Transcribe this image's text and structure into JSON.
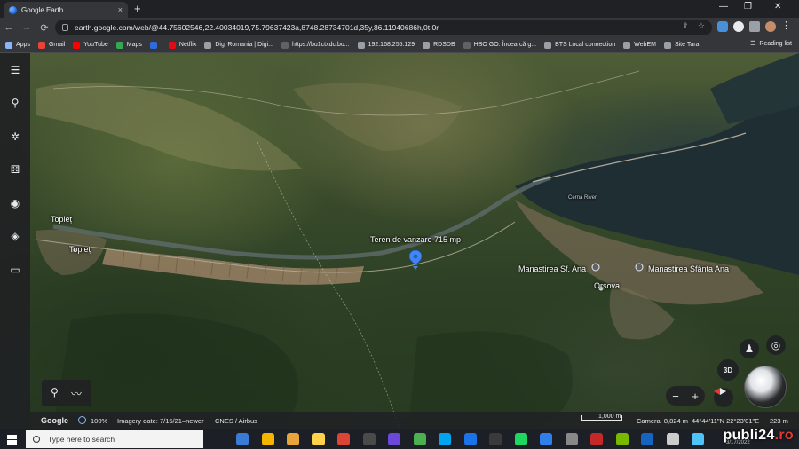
{
  "browser": {
    "tab_title": "Google Earth",
    "tab_close": "×",
    "new_tab": "+",
    "window_controls": [
      "—",
      "❐",
      "✕"
    ],
    "url": "earth.google.com/web/@44.75602546,22.40034019,75.79637423a,8748.28734701d,35y,86.11940686h,0t,0r",
    "bookmarks": [
      {
        "label": "Apps",
        "color": "#8ab4f8"
      },
      {
        "label": "Gmail",
        "color": "#ea4335"
      },
      {
        "label": "YouTube",
        "color": "#ff0000"
      },
      {
        "label": "Maps",
        "color": "#34a853"
      },
      {
        "label": "",
        "color": "#2d6cdf"
      },
      {
        "label": "Netflix",
        "color": "#e50914"
      },
      {
        "label": "Digi Romania | Digi...",
        "color": "#9aa0a6"
      },
      {
        "label": "https://bu1ctxdc.bu...",
        "color": "#5f6368"
      },
      {
        "label": "192.168.255.129",
        "color": "#9aa0a6"
      },
      {
        "label": "RDSDB",
        "color": "#9aa0a6"
      },
      {
        "label": "HBO GO. Încearcă g...",
        "color": "#5f6368"
      },
      {
        "label": "BTS Local connection",
        "color": "#9aa0a6"
      },
      {
        "label": "WebEM",
        "color": "#9aa0a6"
      },
      {
        "label": "Site Tara",
        "color": "#9aa0a6"
      }
    ],
    "reading_list": "Reading list"
  },
  "map": {
    "labels": {
      "toplet_1": "Topleț",
      "toplet_2": "Topleț",
      "placemark": "Teren de vanzare 715 mp",
      "manastirea_sf_ana": "Manastirea Sf. Ana",
      "orsova": "Orșova",
      "manastirea_sfanta_ana": "Manastirea Sfânta Ana",
      "cerna_river": "Cerna River"
    },
    "controls": {
      "mode_3d": "3D",
      "zoom_out": "−",
      "zoom_in": "+"
    }
  },
  "status": {
    "brand": "Google",
    "zoom": "100%",
    "imagery": "Imagery date: 7/15/21–newer",
    "credits": "CNES / Airbus",
    "scale": "1,000 m",
    "camera": "Camera: 8,824 m",
    "coords": "44°44'11\"N 22°23'01\"E",
    "elevation": "223 m"
  },
  "taskbar": {
    "search_placeholder": "Type here to search",
    "date_fragment": "3/17/2022"
  },
  "watermark": {
    "text": "publi24",
    "suffix": ".ro"
  }
}
